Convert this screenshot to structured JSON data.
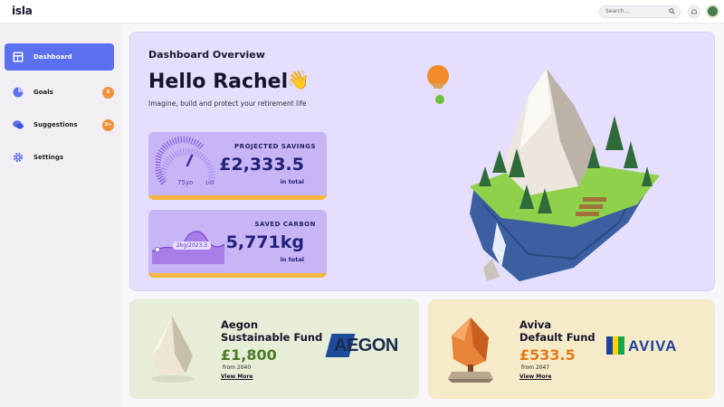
{
  "app": {
    "logo": "isla"
  },
  "search": {
    "placeholder": "Search..."
  },
  "sidebar": {
    "items": [
      {
        "label": "Dashboard",
        "icon": "dashboard-icon",
        "active": true
      },
      {
        "label": "Goals",
        "icon": "goals-icon",
        "badge": "8"
      },
      {
        "label": "Suggestions",
        "icon": "chat-icon",
        "badge": "9+"
      },
      {
        "label": "Settings",
        "icon": "gear-icon"
      }
    ]
  },
  "hero": {
    "subtitle": "Dashboard Overview",
    "title": "Hello Rachel",
    "emoji": "👋",
    "tagline": "Imagine, build and protect your retirement life"
  },
  "stats": {
    "savings": {
      "label": "PROJECTED SAVINGS",
      "value": "£2,333.5",
      "note": "in total",
      "gauge_value": "75yo",
      "gauge_max": "100"
    },
    "carbon": {
      "label": "SAVED CARBON",
      "value": "5,771kg",
      "note": "in total",
      "chart_label": "2kg/2023.3"
    }
  },
  "funds": [
    {
      "name_line1": "Aegon",
      "name_line2": "Sustainable Fund",
      "amount": "£1,800",
      "from": "from 2040",
      "link": "View More",
      "logo": "AEGON",
      "amount_color": "#4d7a28"
    },
    {
      "name_line1": "Aviva",
      "name_line2": "Default Fund",
      "amount": "£533.5",
      "from": "from 2047",
      "link": "View More",
      "logo": "AVIVA",
      "amount_color": "#e07a1c"
    }
  ],
  "colors": {
    "accent": "#5b6ff0",
    "badge": "#f0923a",
    "hero_bg": "#e5defc",
    "stat_card": "#c7b5f5",
    "stat_underline": "#f4b63f"
  }
}
